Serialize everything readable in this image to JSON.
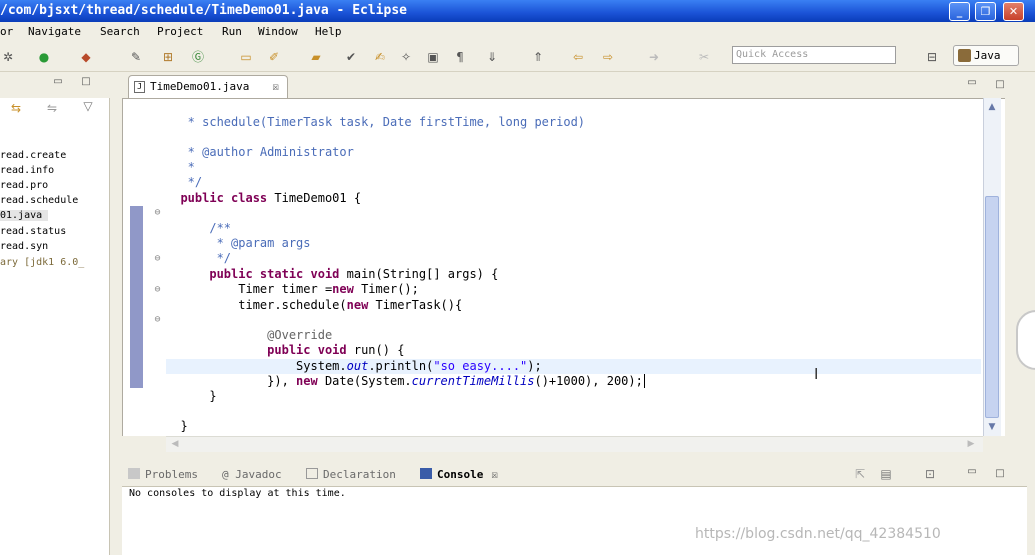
{
  "window": {
    "title": "/com/bjsxt/thread/schedule/TimeDemo01.java - Eclipse",
    "minimize": "_",
    "maximize": "❐",
    "close": "✕"
  },
  "menu": [
    "or",
    "Navigate",
    "Search",
    "Project",
    "Run",
    "Window",
    "Help"
  ],
  "toolbar": {
    "quick_access_placeholder": "Quick Access",
    "perspective": "Java"
  },
  "explorer": {
    "items": [
      "read.create",
      "read.info",
      "read.pro",
      "read.schedule",
      "01.java",
      "read.status",
      "read.syn",
      "ary [jdk1 6.0_"
    ],
    "selected_index": 4
  },
  "editor": {
    "tab_label": "TimeDemo01.java",
    "tab_close": "☒",
    "lines": [
      {
        "segs": [
          {
            "c": "cmt",
            "t": " * schedule(TimerTask task, Date firstTime, long period)"
          }
        ]
      },
      {
        "segs": [
          {
            "c": "cmt",
            "t": " * @author Administrator"
          }
        ]
      },
      {
        "segs": [
          {
            "c": "cmt",
            "t": " *"
          }
        ]
      },
      {
        "segs": [
          {
            "c": "cmt",
            "t": " */"
          }
        ]
      },
      {
        "segs": [
          {
            "c": "kw",
            "t": "public class "
          },
          {
            "c": "",
            "t": "TimeDemo01 {"
          }
        ]
      },
      {
        "segs": [
          {
            "c": "cmt",
            "t": "    /**"
          }
        ]
      },
      {
        "segs": [
          {
            "c": "cmt",
            "t": "     * @param args"
          }
        ]
      },
      {
        "segs": [
          {
            "c": "cmt",
            "t": "     */"
          }
        ]
      },
      {
        "segs": [
          {
            "c": "kw",
            "t": "    public static void "
          },
          {
            "c": "",
            "t": "main(String[] args) {"
          }
        ]
      },
      {
        "segs": [
          {
            "c": "",
            "t": "        Timer timer ="
          },
          {
            "c": "kw",
            "t": "new "
          },
          {
            "c": "",
            "t": "Timer();"
          }
        ]
      },
      {
        "segs": [
          {
            "c": "",
            "t": "        timer.schedule("
          },
          {
            "c": "kw",
            "t": "new "
          },
          {
            "c": "",
            "t": "TimerTask(){"
          }
        ]
      },
      {
        "segs": [
          {
            "c": "ann",
            "t": "            @Override"
          }
        ]
      },
      {
        "segs": [
          {
            "c": "kw",
            "t": "            public void "
          },
          {
            "c": "",
            "t": "run() {"
          }
        ]
      },
      {
        "segs": [
          {
            "c": "",
            "t": "                System."
          },
          {
            "c": "it",
            "t": "out"
          },
          {
            "c": "",
            "t": ".println("
          },
          {
            "c": "str",
            "t": "\"so easy....\""
          },
          {
            "c": "",
            "t": ");"
          }
        ]
      },
      {
        "segs": [
          {
            "c": "",
            "t": "            }), "
          },
          {
            "c": "kw",
            "t": "new "
          },
          {
            "c": "",
            "t": "Date(System."
          },
          {
            "c": "it",
            "t": "currentTimeMillis"
          },
          {
            "c": "",
            "t": "()+1000), 200);"
          }
        ]
      },
      {
        "segs": [
          {
            "c": "",
            "t": "    }"
          }
        ]
      },
      {
        "segs": [
          {
            "c": "",
            "t": "}"
          }
        ]
      }
    ]
  },
  "bottom": {
    "tabs": [
      "Problems",
      "Javadoc",
      "Declaration",
      "Console"
    ],
    "active_tab": "Console",
    "console_message": "No consoles to display at this time."
  },
  "watermark": "https://blog.csdn.net/qq_42384510"
}
